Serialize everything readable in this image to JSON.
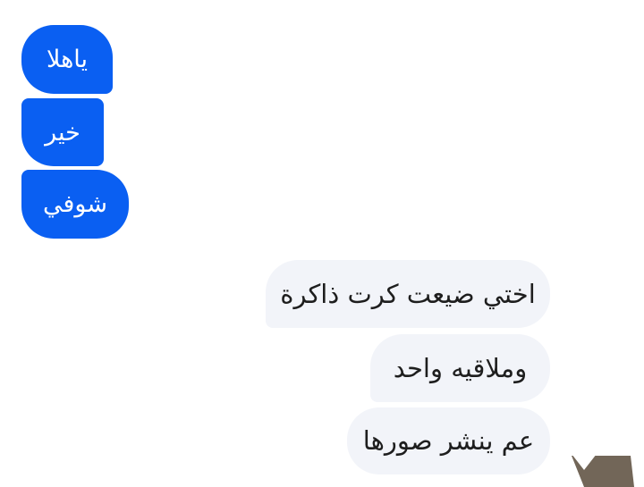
{
  "conversation": {
    "sent_messages": [
      {
        "text": "ياهلا"
      },
      {
        "text": "خير"
      },
      {
        "text": "شوفي"
      }
    ],
    "received_messages": [
      {
        "text": "اختي ضيعت كرت ذاكرة"
      },
      {
        "text": "وملاقيه واحد"
      },
      {
        "text": "عم ينشر صورها"
      }
    ]
  },
  "colors": {
    "sent_bubble": "#0a5ff2",
    "received_bubble": "#f2f4f9",
    "background": "#ffffff",
    "corner_shape": "#726658"
  }
}
